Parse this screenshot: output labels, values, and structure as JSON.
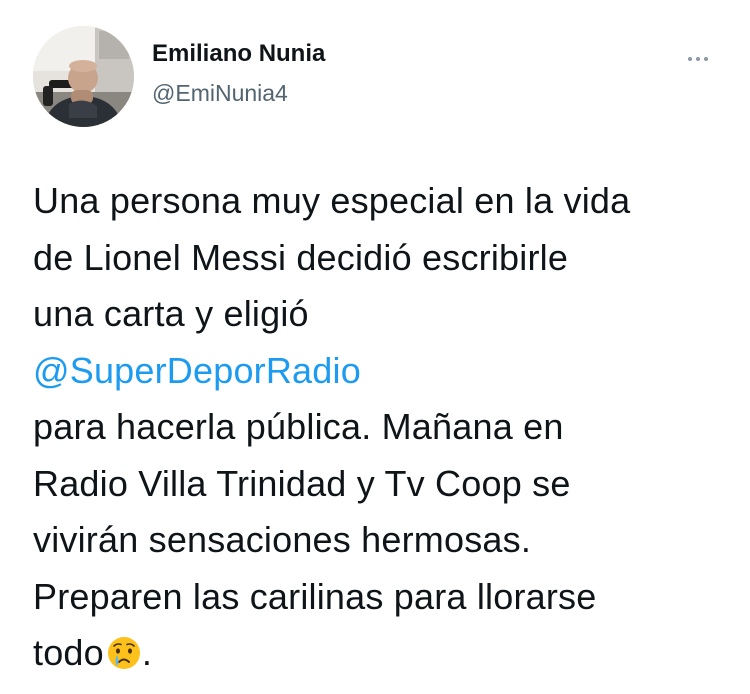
{
  "author": {
    "display_name": "Emiliano Nunia",
    "handle": "@EmiNunia4",
    "avatar": "profile-photo"
  },
  "menu": {
    "icon": "more-horizontal-icon"
  },
  "tweet": {
    "line1": "Una persona muy especial en la vida",
    "line2": "de Lionel Messi decidió escribirle",
    "line3": "una carta y eligió",
    "mention": "@SuperDeporRadio",
    "line5": "para hacerla pública. Mañana en",
    "line6": "Radio Villa Trinidad y Tv Coop se",
    "line7": "vivirán sensaciones hermosas.",
    "line8": "Preparen las carilinas para llorarse",
    "line9_start": "todo",
    "line9_end": ".",
    "emoji": "crying-face-emoji"
  },
  "colors": {
    "link": "#1d9bf0",
    "secondary_text": "#536471",
    "primary_text": "#0f1419"
  }
}
